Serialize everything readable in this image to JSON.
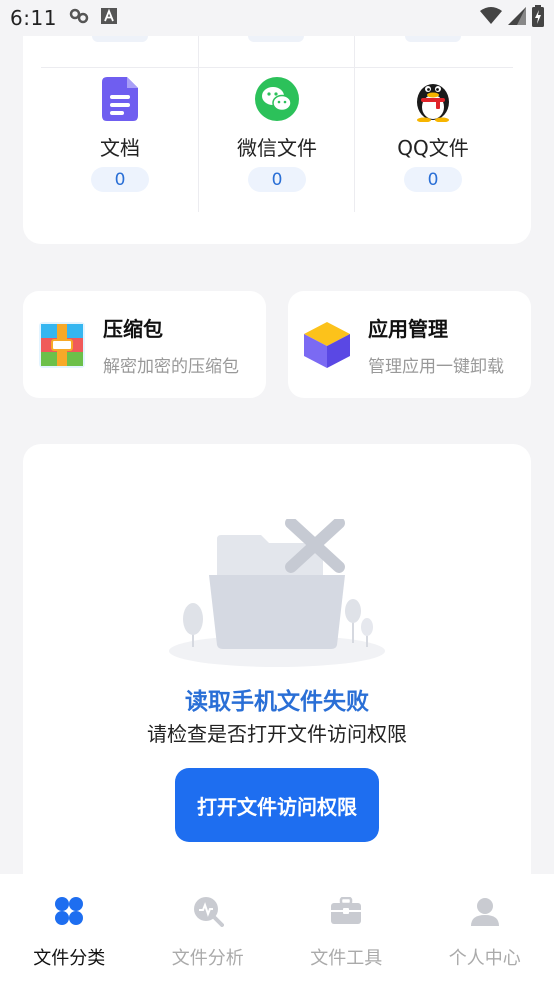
{
  "status_bar": {
    "time": "6:11"
  },
  "categories": [
    {
      "label": "文档",
      "count": "0",
      "icon": "document-icon"
    },
    {
      "label": "微信文件",
      "count": "0",
      "icon": "wechat-icon"
    },
    {
      "label": "QQ文件",
      "count": "0",
      "icon": "qq-icon"
    }
  ],
  "features": [
    {
      "title": "压缩包",
      "subtitle": "解密加密的压缩包",
      "icon": "archive-icon"
    },
    {
      "title": "应用管理",
      "subtitle": "管理应用一键卸载",
      "icon": "app-box-icon"
    }
  ],
  "permission": {
    "title": "读取手机文件失败",
    "subtitle": "请检查是否打开文件访问权限",
    "button_label": "打开文件访问权限"
  },
  "bottom_nav": [
    {
      "label": "文件分类",
      "icon": "category-icon",
      "active": true
    },
    {
      "label": "文件分析",
      "icon": "analysis-icon",
      "active": false
    },
    {
      "label": "文件工具",
      "icon": "toolbox-icon",
      "active": false
    },
    {
      "label": "个人中心",
      "icon": "user-icon",
      "active": false
    }
  ],
  "colors": {
    "accent": "#1e6ef0",
    "accent_text": "#2a6fd6",
    "background": "#f4f4f6"
  }
}
